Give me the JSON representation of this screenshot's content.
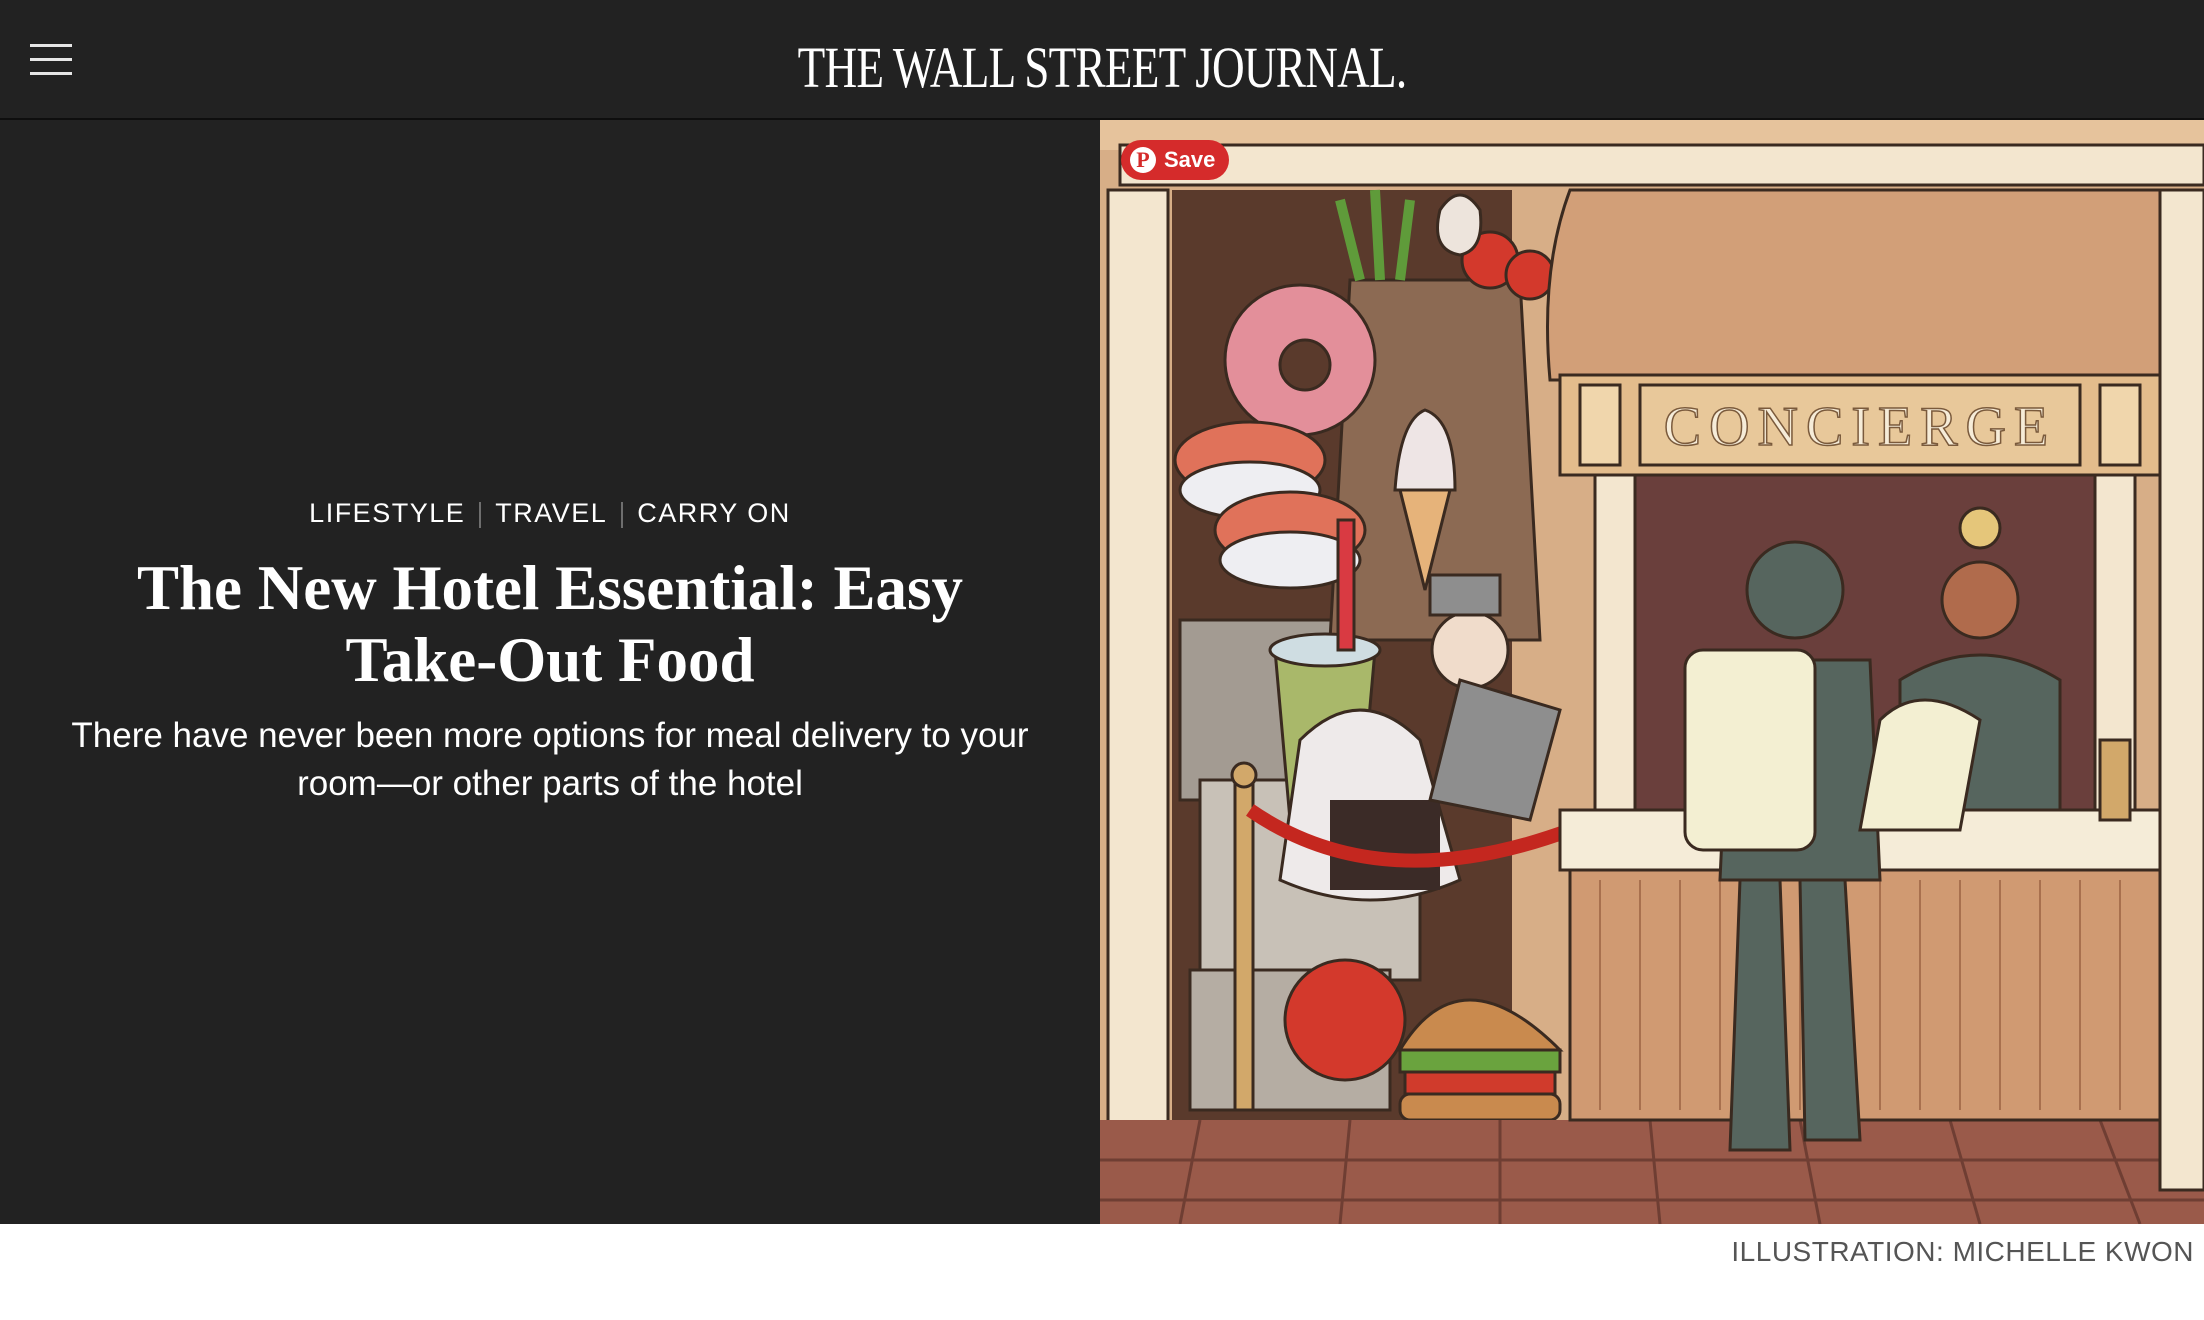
{
  "header": {
    "logo": "THE WALL STREET JOURNAL."
  },
  "article": {
    "breadcrumbs": [
      "LIFESTYLE",
      "TRAVEL",
      "CARRY ON"
    ],
    "headline": "The New Hotel Essential: Easy Take-Out Food",
    "dek": "There have never been more options for meal delivery to your room—or other parts of the hotel",
    "caption": "ILLUSTRATION: MICHELLE KWON"
  },
  "pin": {
    "save_label": "Save",
    "icon_glyph": "P"
  },
  "illustration": {
    "sign_text": "CONCIERGE"
  },
  "colors": {
    "header_bg": "#222222",
    "pin_red": "#d52b2b"
  }
}
